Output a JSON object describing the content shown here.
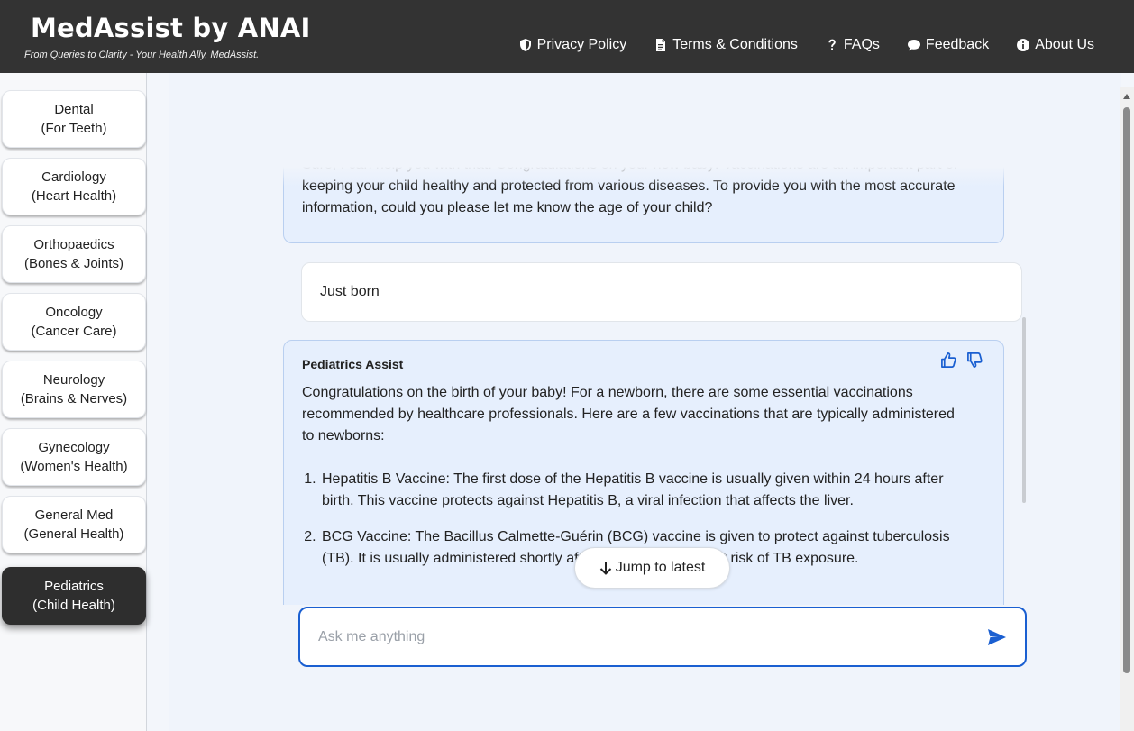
{
  "header": {
    "title": "MedAssist by ANAI",
    "tagline": "From Queries to Clarity - Your Health Ally, MedAssist.",
    "nav": [
      {
        "label": "Privacy Policy",
        "icon": "shield-icon"
      },
      {
        "label": "Terms & Conditions",
        "icon": "document-icon"
      },
      {
        "label": "FAQs",
        "icon": "question-icon"
      },
      {
        "label": "Feedback",
        "icon": "chat-bubble-icon"
      },
      {
        "label": "About Us",
        "icon": "info-icon"
      }
    ]
  },
  "sidebar": {
    "items": [
      {
        "line1": "Dental",
        "line2": "(For Teeth)",
        "active": false
      },
      {
        "line1": "Cardiology",
        "line2": "(Heart Health)",
        "active": false
      },
      {
        "line1": "Orthopaedics",
        "line2": "(Bones & Joints)",
        "active": false
      },
      {
        "line1": "Oncology",
        "line2": "(Cancer Care)",
        "active": false
      },
      {
        "line1": "Neurology",
        "line2": "(Brains & Nerves)",
        "active": false
      },
      {
        "line1": "Gynecology",
        "line2": "(Women's Health)",
        "active": false
      },
      {
        "line1": "General Med",
        "line2": "(General Health)",
        "active": false
      },
      {
        "line1": "Pediatrics",
        "line2": "(Child Health)",
        "active": true
      }
    ]
  },
  "chat": {
    "messages": [
      {
        "role": "assistant",
        "text": "Sure, I can help you with that. Congratulations on your new baby! Vaccinations are an important part of keeping your child healthy and protected from various diseases. To provide you with the most accurate information, could you please let me know the age of your child?"
      },
      {
        "role": "user",
        "text": "Just born"
      },
      {
        "role": "assistant",
        "sender": "Pediatrics Assist",
        "intro": "Congratulations on the birth of your baby! For a newborn, there are some essential vaccinations recommended by healthcare professionals. Here are a few vaccinations that are typically administered to newborns:",
        "list": [
          "Hepatitis B Vaccine: The first dose of the Hepatitis B vaccine is usually given within 24 hours after birth. This vaccine protects against Hepatitis B, a viral infection that affects the liver.",
          "BCG Vaccine: The Bacillus Calmette-Guérin (BCG) vaccine is given to protect against tuberculosis (TB). It is usually administered shortly after birth if the child is at risk of TB exposure."
        ]
      }
    ],
    "jump_label": "Jump to latest",
    "input_placeholder": "Ask me anything",
    "accent": "#1a5fd1"
  }
}
